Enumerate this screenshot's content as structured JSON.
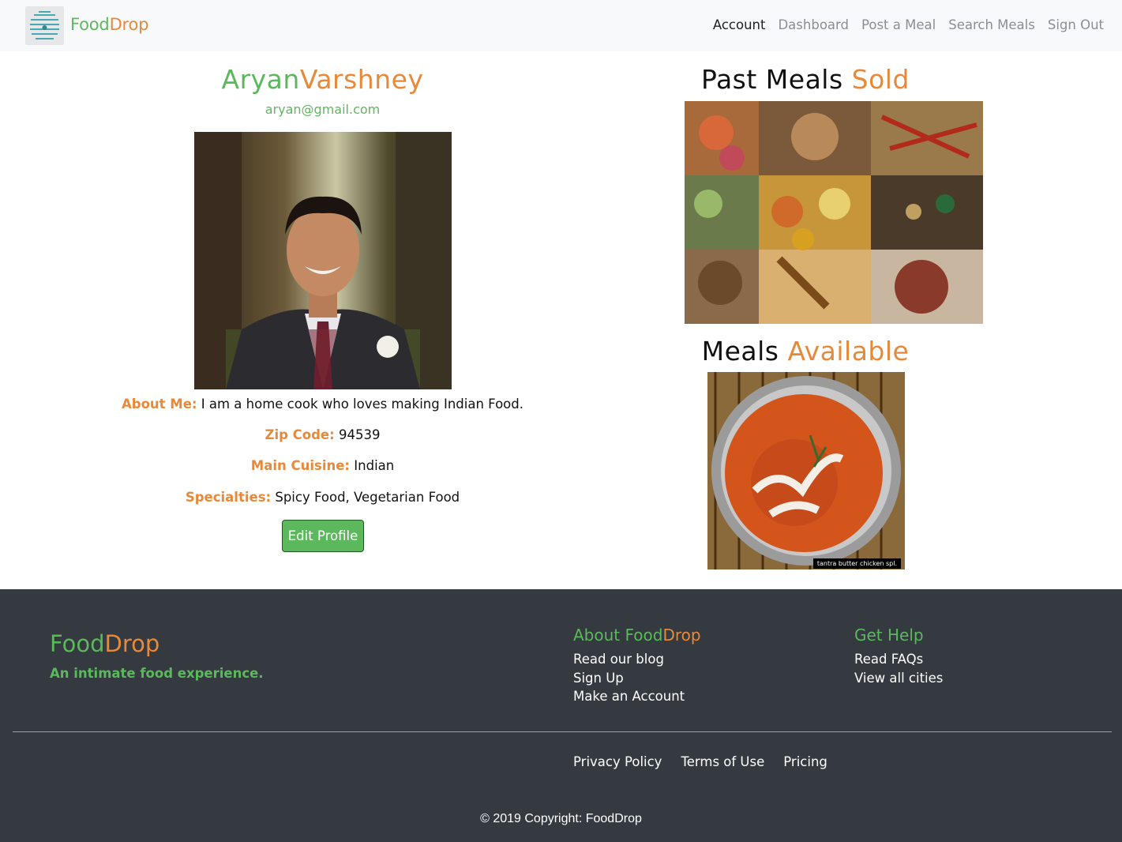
{
  "brand": {
    "part1": "Food",
    "part2": "Drop",
    "logo_icon": "beehive-icon"
  },
  "nav": {
    "items": [
      {
        "label": "Account",
        "active": true
      },
      {
        "label": "Dashboard",
        "active": false
      },
      {
        "label": "Post a Meal",
        "active": false
      },
      {
        "label": "Search Meals",
        "active": false
      },
      {
        "label": "Sign Out",
        "active": false
      }
    ]
  },
  "profile": {
    "first_name": "Aryan",
    "last_name": "Varshney",
    "email": "aryan@gmail.com",
    "photo": "profile-photo",
    "about": {
      "label": "About Me:",
      "value": "I am a home cook who loves making Indian Food."
    },
    "zip": {
      "label": "Zip Code:",
      "value": "94539"
    },
    "cuisine": {
      "label": "Main Cuisine:",
      "value": "Indian"
    },
    "specialties": {
      "label": "Specialties:",
      "value": "Spicy Food, Vegetarian Food"
    },
    "edit_label": "Edit Profile"
  },
  "past_meals": {
    "title_a": "Past Meals",
    "title_b": "Sold"
  },
  "available": {
    "title_a": "Meals",
    "title_b": "Available",
    "meal_caption": "tantra butter chicken spl."
  },
  "footer": {
    "brand_a": "Food",
    "brand_b": "Drop",
    "tagline": "An intimate food experience.",
    "about_head_a": "About ",
    "about_head_b": "Food",
    "about_head_c": "Drop",
    "about_links": [
      "Read our blog",
      "Sign Up",
      "Make an Account"
    ],
    "help_head": "Get Help",
    "help_links": [
      "Read FAQs",
      "View all cities"
    ],
    "legal": [
      "Privacy Policy",
      "Terms of Use",
      "Pricing"
    ],
    "copyright": "© 2019 Copyright: FoodDrop"
  },
  "colors": {
    "green": "#5cb85c",
    "orange": "#e8893a",
    "footer_bg": "#343a40",
    "navbar_bg": "#f8f9fa"
  }
}
